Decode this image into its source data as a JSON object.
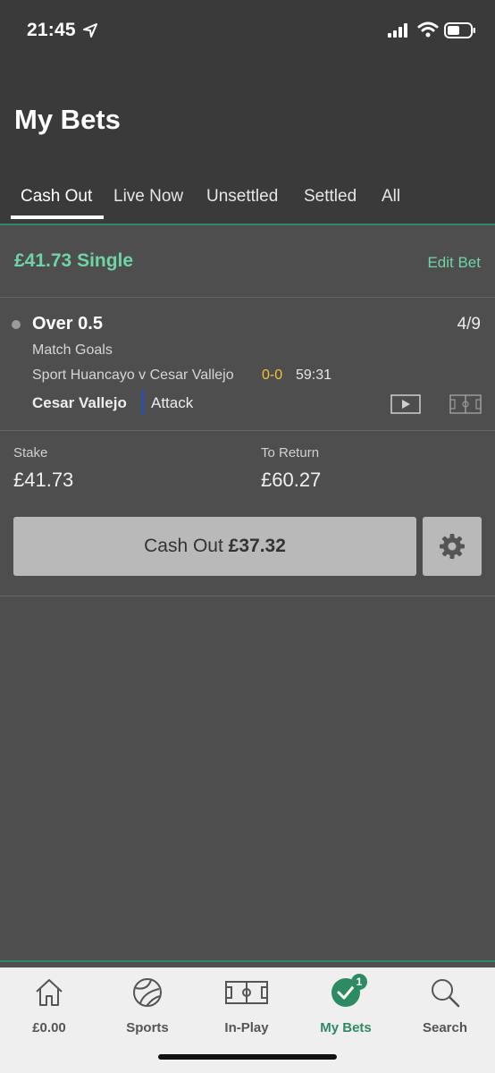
{
  "status_bar": {
    "time": "21:45"
  },
  "page": {
    "title": "My Bets"
  },
  "tabs": [
    {
      "label": "Cash Out",
      "active": true
    },
    {
      "label": "Live Now",
      "active": false
    },
    {
      "label": "Unsettled",
      "active": false
    },
    {
      "label": "Settled",
      "active": false
    },
    {
      "label": "All",
      "active": false
    }
  ],
  "bet": {
    "title": "£41.73 Single",
    "edit_label": "Edit Bet",
    "selection": {
      "name": "Over 0.5",
      "odds": "4/9",
      "market": "Match Goals",
      "event": "Sport Huancayo v Cesar Vallejo",
      "score": "0-0",
      "clock": "59:31",
      "team": "Cesar Vallejo",
      "state": "Attack"
    },
    "stake_label": "Stake",
    "stake_value": "£41.73",
    "return_label": "To Return",
    "return_value": "£60.27",
    "cashout_label": "Cash Out",
    "cashout_amount": "£37.32"
  },
  "colors": {
    "accent": "#6fd3a6",
    "brand_green": "#2e8a63",
    "score": "#f2c230",
    "team_bar": "#2a4fa8"
  },
  "bottom_nav": [
    {
      "label": "£0.00",
      "icon": "home-icon"
    },
    {
      "label": "Sports",
      "icon": "football-icon"
    },
    {
      "label": "In-Play",
      "icon": "pitch-icon"
    },
    {
      "label": "My Bets",
      "icon": "check-icon",
      "badge": "1",
      "active": true
    },
    {
      "label": "Search",
      "icon": "search-icon"
    }
  ]
}
